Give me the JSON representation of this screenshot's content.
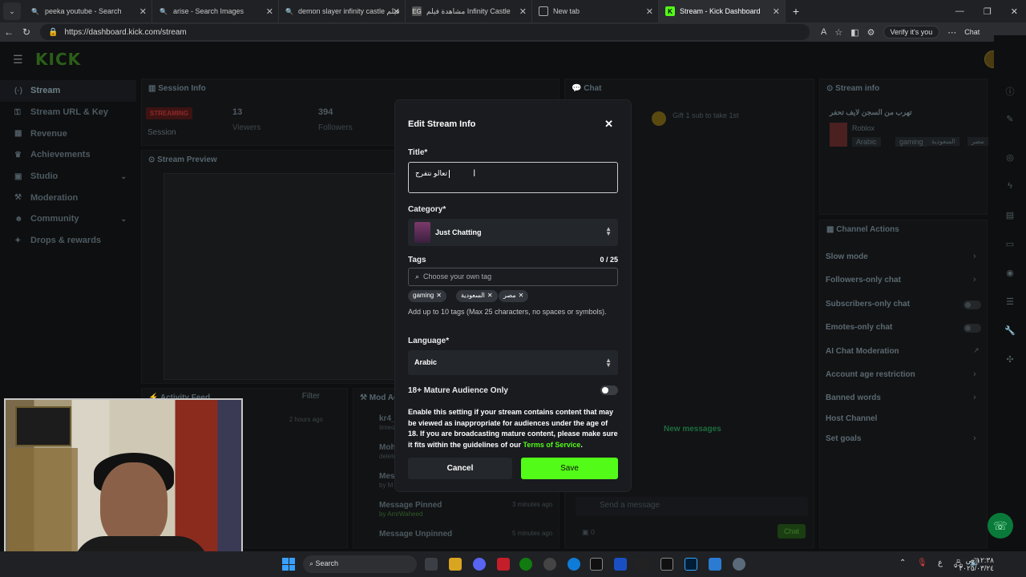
{
  "browser": {
    "tabs": [
      {
        "label": "peeka youtube - Search"
      },
      {
        "label": "arise - Search Images"
      },
      {
        "label": "demon slayer infinity castle فيلم"
      },
      {
        "label": "مشاهدة فيلم Infinity Castle"
      },
      {
        "label": "New tab"
      },
      {
        "label": "Stream - Kick Dashboard"
      }
    ],
    "url": "https://dashboard.kick.com/stream",
    "verify_label": "Verify it's you",
    "chat_label": "Chat"
  },
  "sidebar": {
    "items": [
      {
        "label": "Stream"
      },
      {
        "label": "Stream URL & Key"
      },
      {
        "label": "Revenue"
      },
      {
        "label": "Achievements"
      },
      {
        "label": "Studio"
      },
      {
        "label": "Moderation"
      },
      {
        "label": "Community"
      },
      {
        "label": "Drops & rewards"
      }
    ]
  },
  "logo": "KICK",
  "session": {
    "title": "Session Info",
    "badge": "STREAMING",
    "session_label": "Session",
    "viewers_value": "13",
    "viewers_label": "Viewers",
    "followers_value": "394",
    "followers_label": "Followers"
  },
  "preview": {
    "title": "Stream Preview"
  },
  "activity": {
    "title": "Activity Feed",
    "filter": "Filter",
    "time": "2 hours ago"
  },
  "modactions": {
    "title": "Mod Actions",
    "items": [
      {
        "label": "kr4_",
        "sub": "timeout"
      },
      {
        "label": "Moh",
        "sub": "delete"
      },
      {
        "label": "Mess",
        "sub": "by M"
      },
      {
        "label": "Message Pinned",
        "by": "by AmrWaheed",
        "time": "3 minutes ago"
      },
      {
        "label": "Message Unpinned",
        "time": "5 minutes ago"
      }
    ]
  },
  "chat": {
    "title": "Chat",
    "gift": "Gift 1 sub to take 1st",
    "new_messages": "New messages",
    "input_placeholder": "Send a message",
    "count": "0",
    "send": "Chat"
  },
  "stream_info": {
    "title": "Stream info",
    "stream_title": "تهرب من السجن لايف تحفر",
    "category": "Roblox",
    "tags": [
      "Arabic",
      "gaming",
      "السعودية",
      "مصر"
    ]
  },
  "channel_actions": {
    "title": "Channel Actions",
    "items": [
      {
        "label": "Slow mode",
        "kind": "chevron"
      },
      {
        "label": "Followers-only chat",
        "kind": "chevron"
      },
      {
        "label": "Subscribers-only chat",
        "kind": "toggle"
      },
      {
        "label": "Emotes-only chat",
        "kind": "toggle"
      },
      {
        "label": "AI Chat Moderation",
        "kind": "external"
      },
      {
        "label": "Account age restriction",
        "kind": "chevron"
      },
      {
        "label": "Banned words",
        "kind": "chevron"
      },
      {
        "label": "Host Channel",
        "kind": "none"
      },
      {
        "label": "Set goals",
        "kind": "chevron"
      }
    ]
  },
  "modal": {
    "title": "Edit Stream Info",
    "title_label": "Title*",
    "title_value": "تعالو نتفرج",
    "category_label": "Category*",
    "category_value": "Just Chatting",
    "tags_label": "Tags",
    "tags_count": "0 / 25",
    "tags_placeholder": "Choose your own tag",
    "tags": [
      "gaming",
      "السعودية",
      "مصر"
    ],
    "tags_help": "Add up to 10 tags (Max 25 characters, no spaces or symbols).",
    "language_label": "Language*",
    "language_value": "Arabic",
    "mature_label": "18+ Mature Audience Only",
    "mature_on": false,
    "mature_text": "Enable this setting if your stream contains content that may be viewed as inappropriate for audiences under the age of 18. If you are broadcasting mature content, please make sure it fits within the guidelines of our",
    "tos_link": "Terms of Service",
    "tos_end": ".",
    "cancel": "Cancel",
    "save": "Save",
    "accent": "#53fc18"
  },
  "taskbar": {
    "search": "Search",
    "time": "١٢:٣٨ ص",
    "date": "٢٠٢٥/٠٣/٢٤",
    "lang": "ع"
  }
}
